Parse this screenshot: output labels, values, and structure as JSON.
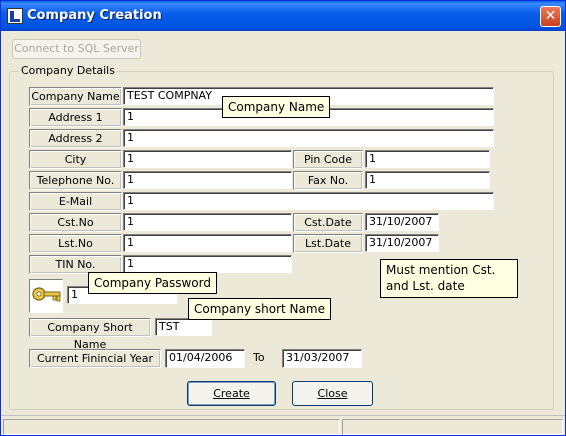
{
  "window": {
    "title": "Company Creation",
    "close_glyph": "✕",
    "colors": {
      "titlebar": "#0054e3",
      "face": "#ece9d8",
      "tooltip": "#ffffe1"
    }
  },
  "toolbar": {
    "connect_label": "Connect to SQL Server"
  },
  "group": {
    "label": "Company Details"
  },
  "fields": {
    "company_name": {
      "label": "Company Name",
      "value": "TEST COMPNAY"
    },
    "address1": {
      "label": "Address 1",
      "value": "1"
    },
    "address2": {
      "label": "Address 2",
      "value": "1"
    },
    "city": {
      "label": "City",
      "value": "1"
    },
    "pin_code": {
      "label": "Pin Code",
      "value": "1"
    },
    "telephone": {
      "label": "Telephone No.",
      "value": "1"
    },
    "fax": {
      "label": "Fax No.",
      "value": "1"
    },
    "email": {
      "label": "E-Mail",
      "value": "1"
    },
    "cst_no": {
      "label": "Cst.No",
      "value": "1"
    },
    "cst_date": {
      "label": "Cst.Date",
      "value": "31/10/2007"
    },
    "lst_no": {
      "label": "Lst.No",
      "value": "1"
    },
    "lst_date": {
      "label": "Lst.Date",
      "value": "31/10/2007"
    },
    "tin_no": {
      "label": "TIN No.",
      "value": "1"
    },
    "password": {
      "value": "1",
      "icon": "key-icon"
    },
    "short_name": {
      "label": "Company Short Name",
      "value": "TST"
    },
    "fin_year": {
      "label": "Current Finincial Year",
      "from": "01/04/2006",
      "to_label": "To",
      "to": "31/03/2007"
    }
  },
  "tooltips": {
    "company_name": "Company Name",
    "password": "Company Password",
    "short_name": "Company short Name",
    "dates": "Must mention Cst. and Lst. date"
  },
  "buttons": {
    "create": "Create",
    "close": "Close"
  }
}
